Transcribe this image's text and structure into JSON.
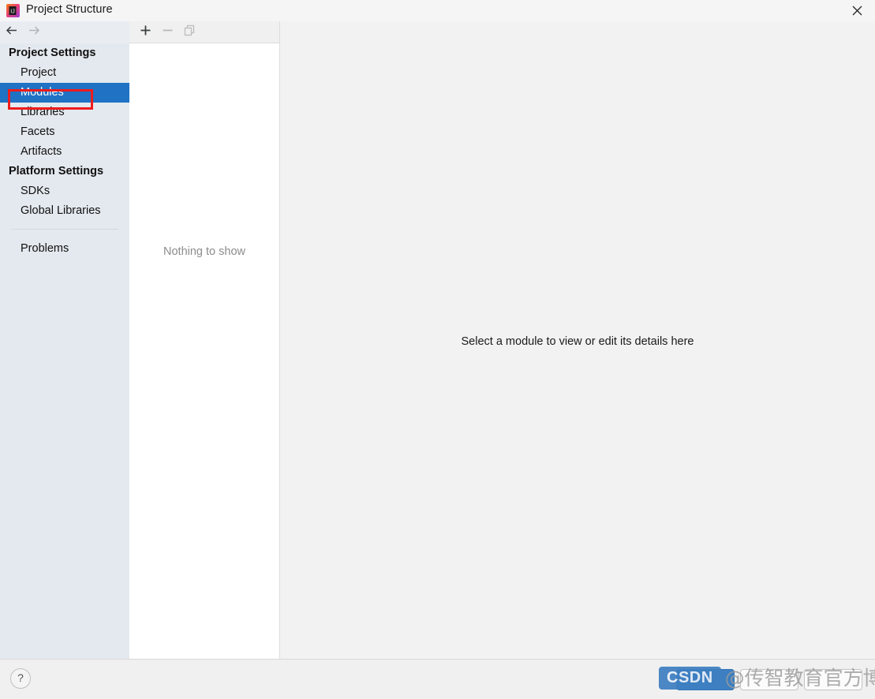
{
  "window": {
    "title": "Project Structure",
    "app_icon": "intellij-idea-icon",
    "close_label": "×"
  },
  "nav": {
    "back_icon": "arrow-left-icon",
    "forward_icon": "arrow-right-icon",
    "back_enabled": true,
    "forward_enabled": false
  },
  "sidebar": {
    "background": "#e4e9ef",
    "selected_color": "#1f72c4",
    "groups": [
      {
        "label": "Project Settings",
        "items": [
          {
            "label": "Project",
            "selected": false
          },
          {
            "label": "Modules",
            "selected": true
          },
          {
            "label": "Libraries",
            "selected": false
          },
          {
            "label": "Facets",
            "selected": false
          },
          {
            "label": "Artifacts",
            "selected": false
          }
        ]
      },
      {
        "label": "Platform Settings",
        "items": [
          {
            "label": "SDKs",
            "selected": false
          },
          {
            "label": "Global Libraries",
            "selected": false
          }
        ]
      }
    ],
    "problems": {
      "label": "Problems"
    }
  },
  "annotation": {
    "color": "#ef1c1c",
    "target": "Modules"
  },
  "center_panel": {
    "toolbar": {
      "add": {
        "icon": "plus-icon",
        "enabled": true
      },
      "remove": {
        "icon": "minus-icon",
        "enabled": false
      },
      "copy": {
        "icon": "copy-icon",
        "enabled": false
      }
    },
    "empty_message": "Nothing to show"
  },
  "detail_panel": {
    "message": "Select a module to view or edit its details here"
  },
  "footer": {
    "help": {
      "icon": "question-mark-icon",
      "label": "?"
    },
    "buttons": [
      {
        "label": "",
        "style": "primary",
        "name": "ok-button"
      },
      {
        "label": "",
        "style": "default",
        "name": "cancel-button"
      },
      {
        "label": "",
        "style": "default",
        "name": "apply-button"
      }
    ]
  },
  "watermark": {
    "logo_text": "CSDN",
    "text": "@传智教育官方博客",
    "logo_color": "#3d7fc1"
  }
}
